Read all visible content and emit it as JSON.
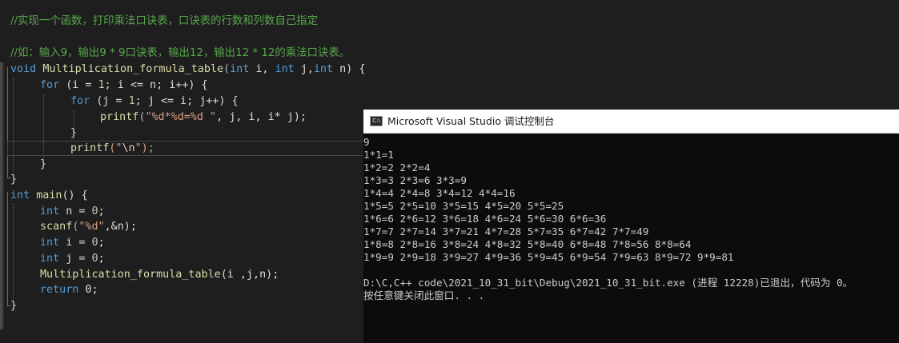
{
  "editor": {
    "comment1": "//实现一个函数，打印乘法口诀表，口诀表的行数和列数自己指定",
    "comment2": "//如：输入9，输出9 * 9口诀表，输出12，输出12 * 12的乘法口诀表。",
    "code": {
      "kw_void": "void",
      "fn_name": "Multiplication_formula_table",
      "params_open": "(",
      "kw_int": "int",
      "p_i": " i, ",
      "p_j": " j,",
      "p_n": " n) {",
      "kw_for": "for",
      "for1_rest": " (i = ",
      "one": "1",
      "for1_mid": "; i <= n; i++) {",
      "for2_rest": " (j = ",
      "for2_mid": "; j <= i; j++) {",
      "fn_printf": "printf",
      "paren_open": "(",
      "printf1_str": "\"%d*%d=%d \"",
      "printf1_args": ", j, i, i* j);",
      "close_brace": "}",
      "printf2_open": "(\"",
      "printf2_esc": "\\n",
      "printf2_close": "\");",
      "fn_main": "main",
      "main_rest": "() {",
      "var_n": " n = ",
      "zero": "0",
      "semi": ";",
      "fn_scanf": "scanf",
      "scanf_str": "\"%d\"",
      "scanf_args": ",&n);",
      "var_i": " i = ",
      "var_j": " j = ",
      "call_args": "(i ,j,n);",
      "kw_return": "return",
      "return_rest": " 0;"
    }
  },
  "console": {
    "title": "Microsoft Visual Studio 调试控制台",
    "icon_label": "C:\\",
    "lines": [
      "9",
      "1*1=1",
      "1*2=2 2*2=4",
      "1*3=3 2*3=6 3*3=9",
      "1*4=4 2*4=8 3*4=12 4*4=16",
      "1*5=5 2*5=10 3*5=15 4*5=20 5*5=25",
      "1*6=6 2*6=12 3*6=18 4*6=24 5*6=30 6*6=36",
      "1*7=7 2*7=14 3*7=21 4*7=28 5*7=35 6*7=42 7*7=49",
      "1*8=8 2*8=16 3*8=24 4*8=32 5*8=40 6*8=48 7*8=56 8*8=64",
      "1*9=9 2*9=18 3*9=27 4*9=36 5*9=45 6*9=54 7*9=63 8*9=72 9*9=81",
      "",
      "D:\\C,C++ code\\2021_10_31_bit\\Debug\\2021_10_31_bit.exe (进程 12228)已退出，代码为 0。",
      "按任意键关闭此窗口. . ."
    ]
  }
}
